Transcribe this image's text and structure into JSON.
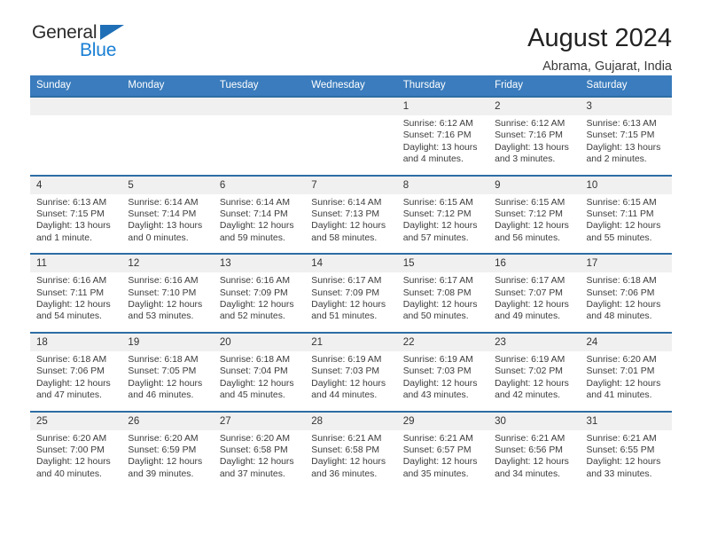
{
  "brand": {
    "name_line1": "General",
    "name_line2": "Blue",
    "triangle_color": "#1f6fb6",
    "blue_text_color": "#1a7fd4"
  },
  "header": {
    "title": "August 2024",
    "subtitle": "Abrama, Gujarat, India"
  },
  "theme": {
    "header_blue": "#3a7cbd",
    "separator_blue": "#2e6da4",
    "daynum_band": "#f0f0f0",
    "text": "#3c3c3c"
  },
  "weekdays": [
    "Sunday",
    "Monday",
    "Tuesday",
    "Wednesday",
    "Thursday",
    "Friday",
    "Saturday"
  ],
  "labels": {
    "sunrise_prefix": "Sunrise:",
    "sunset_prefix": "Sunset:",
    "daylight_prefix": "Daylight:"
  },
  "weeks": [
    {
      "days": [
        {
          "num": "",
          "sunrise": "",
          "sunset": "",
          "daylight": ""
        },
        {
          "num": "",
          "sunrise": "",
          "sunset": "",
          "daylight": ""
        },
        {
          "num": "",
          "sunrise": "",
          "sunset": "",
          "daylight": ""
        },
        {
          "num": "",
          "sunrise": "",
          "sunset": "",
          "daylight": ""
        },
        {
          "num": "1",
          "sunrise": "Sunrise: 6:12 AM",
          "sunset": "Sunset: 7:16 PM",
          "daylight": "Daylight: 13 hours and 4 minutes."
        },
        {
          "num": "2",
          "sunrise": "Sunrise: 6:12 AM",
          "sunset": "Sunset: 7:16 PM",
          "daylight": "Daylight: 13 hours and 3 minutes."
        },
        {
          "num": "3",
          "sunrise": "Sunrise: 6:13 AM",
          "sunset": "Sunset: 7:15 PM",
          "daylight": "Daylight: 13 hours and 2 minutes."
        }
      ]
    },
    {
      "days": [
        {
          "num": "4",
          "sunrise": "Sunrise: 6:13 AM",
          "sunset": "Sunset: 7:15 PM",
          "daylight": "Daylight: 13 hours and 1 minute."
        },
        {
          "num": "5",
          "sunrise": "Sunrise: 6:14 AM",
          "sunset": "Sunset: 7:14 PM",
          "daylight": "Daylight: 13 hours and 0 minutes."
        },
        {
          "num": "6",
          "sunrise": "Sunrise: 6:14 AM",
          "sunset": "Sunset: 7:14 PM",
          "daylight": "Daylight: 12 hours and 59 minutes."
        },
        {
          "num": "7",
          "sunrise": "Sunrise: 6:14 AM",
          "sunset": "Sunset: 7:13 PM",
          "daylight": "Daylight: 12 hours and 58 minutes."
        },
        {
          "num": "8",
          "sunrise": "Sunrise: 6:15 AM",
          "sunset": "Sunset: 7:12 PM",
          "daylight": "Daylight: 12 hours and 57 minutes."
        },
        {
          "num": "9",
          "sunrise": "Sunrise: 6:15 AM",
          "sunset": "Sunset: 7:12 PM",
          "daylight": "Daylight: 12 hours and 56 minutes."
        },
        {
          "num": "10",
          "sunrise": "Sunrise: 6:15 AM",
          "sunset": "Sunset: 7:11 PM",
          "daylight": "Daylight: 12 hours and 55 minutes."
        }
      ]
    },
    {
      "days": [
        {
          "num": "11",
          "sunrise": "Sunrise: 6:16 AM",
          "sunset": "Sunset: 7:11 PM",
          "daylight": "Daylight: 12 hours and 54 minutes."
        },
        {
          "num": "12",
          "sunrise": "Sunrise: 6:16 AM",
          "sunset": "Sunset: 7:10 PM",
          "daylight": "Daylight: 12 hours and 53 minutes."
        },
        {
          "num": "13",
          "sunrise": "Sunrise: 6:16 AM",
          "sunset": "Sunset: 7:09 PM",
          "daylight": "Daylight: 12 hours and 52 minutes."
        },
        {
          "num": "14",
          "sunrise": "Sunrise: 6:17 AM",
          "sunset": "Sunset: 7:09 PM",
          "daylight": "Daylight: 12 hours and 51 minutes."
        },
        {
          "num": "15",
          "sunrise": "Sunrise: 6:17 AM",
          "sunset": "Sunset: 7:08 PM",
          "daylight": "Daylight: 12 hours and 50 minutes."
        },
        {
          "num": "16",
          "sunrise": "Sunrise: 6:17 AM",
          "sunset": "Sunset: 7:07 PM",
          "daylight": "Daylight: 12 hours and 49 minutes."
        },
        {
          "num": "17",
          "sunrise": "Sunrise: 6:18 AM",
          "sunset": "Sunset: 7:06 PM",
          "daylight": "Daylight: 12 hours and 48 minutes."
        }
      ]
    },
    {
      "days": [
        {
          "num": "18",
          "sunrise": "Sunrise: 6:18 AM",
          "sunset": "Sunset: 7:06 PM",
          "daylight": "Daylight: 12 hours and 47 minutes."
        },
        {
          "num": "19",
          "sunrise": "Sunrise: 6:18 AM",
          "sunset": "Sunset: 7:05 PM",
          "daylight": "Daylight: 12 hours and 46 minutes."
        },
        {
          "num": "20",
          "sunrise": "Sunrise: 6:18 AM",
          "sunset": "Sunset: 7:04 PM",
          "daylight": "Daylight: 12 hours and 45 minutes."
        },
        {
          "num": "21",
          "sunrise": "Sunrise: 6:19 AM",
          "sunset": "Sunset: 7:03 PM",
          "daylight": "Daylight: 12 hours and 44 minutes."
        },
        {
          "num": "22",
          "sunrise": "Sunrise: 6:19 AM",
          "sunset": "Sunset: 7:03 PM",
          "daylight": "Daylight: 12 hours and 43 minutes."
        },
        {
          "num": "23",
          "sunrise": "Sunrise: 6:19 AM",
          "sunset": "Sunset: 7:02 PM",
          "daylight": "Daylight: 12 hours and 42 minutes."
        },
        {
          "num": "24",
          "sunrise": "Sunrise: 6:20 AM",
          "sunset": "Sunset: 7:01 PM",
          "daylight": "Daylight: 12 hours and 41 minutes."
        }
      ]
    },
    {
      "days": [
        {
          "num": "25",
          "sunrise": "Sunrise: 6:20 AM",
          "sunset": "Sunset: 7:00 PM",
          "daylight": "Daylight: 12 hours and 40 minutes."
        },
        {
          "num": "26",
          "sunrise": "Sunrise: 6:20 AM",
          "sunset": "Sunset: 6:59 PM",
          "daylight": "Daylight: 12 hours and 39 minutes."
        },
        {
          "num": "27",
          "sunrise": "Sunrise: 6:20 AM",
          "sunset": "Sunset: 6:58 PM",
          "daylight": "Daylight: 12 hours and 37 minutes."
        },
        {
          "num": "28",
          "sunrise": "Sunrise: 6:21 AM",
          "sunset": "Sunset: 6:58 PM",
          "daylight": "Daylight: 12 hours and 36 minutes."
        },
        {
          "num": "29",
          "sunrise": "Sunrise: 6:21 AM",
          "sunset": "Sunset: 6:57 PM",
          "daylight": "Daylight: 12 hours and 35 minutes."
        },
        {
          "num": "30",
          "sunrise": "Sunrise: 6:21 AM",
          "sunset": "Sunset: 6:56 PM",
          "daylight": "Daylight: 12 hours and 34 minutes."
        },
        {
          "num": "31",
          "sunrise": "Sunrise: 6:21 AM",
          "sunset": "Sunset: 6:55 PM",
          "daylight": "Daylight: 12 hours and 33 minutes."
        }
      ]
    }
  ]
}
